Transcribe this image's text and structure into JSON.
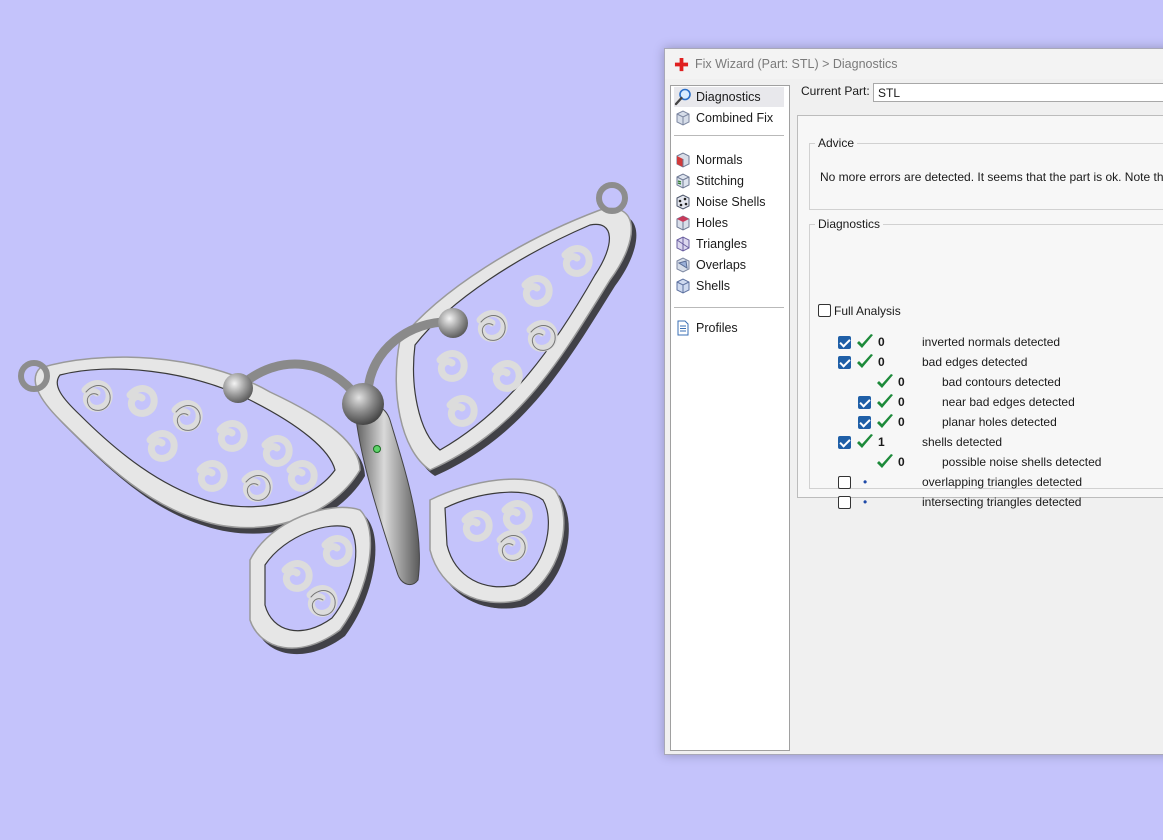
{
  "window": {
    "title": "Fix Wizard (Part: STL) > Diagnostics",
    "accent_color": "#1f5fa7",
    "background_color": "#c4c3fb"
  },
  "nav": {
    "items": [
      {
        "label": "Diagnostics",
        "icon": "magnifier-icon",
        "selected": true
      },
      {
        "label": "Combined Fix",
        "icon": "cube-icon"
      },
      {
        "label": "Normals",
        "icon": "normals-cube-icon"
      },
      {
        "label": "Stitching",
        "icon": "stitching-cube-icon"
      },
      {
        "label": "Noise Shells",
        "icon": "noise-shells-icon"
      },
      {
        "label": "Holes",
        "icon": "holes-cube-icon"
      },
      {
        "label": "Triangles",
        "icon": "triangles-icon"
      },
      {
        "label": "Overlaps",
        "icon": "overlaps-icon"
      },
      {
        "label": "Shells",
        "icon": "shells-cube-icon"
      },
      {
        "label": "Profiles",
        "icon": "document-icon"
      }
    ]
  },
  "current_part": {
    "label": "Current Part:",
    "value": "STL"
  },
  "advice": {
    "title": "Advice",
    "text": "No more errors are detected. It seems that the part is ok. Note that no"
  },
  "diagnostics": {
    "title": "Diagnostics",
    "full_analysis_label": "Full Analysis",
    "full_analysis_checked": false,
    "rows": [
      {
        "checked": true,
        "status": "ok",
        "count": "0",
        "label": "inverted normals detected",
        "indent": 0
      },
      {
        "checked": true,
        "status": "ok",
        "count": "0",
        "label": "bad edges detected",
        "indent": 0
      },
      {
        "checked": null,
        "status": "ok",
        "count": "0",
        "label": "bad contours detected",
        "indent": 1
      },
      {
        "checked": true,
        "status": "ok",
        "count": "0",
        "label": "near bad edges detected",
        "indent": 1
      },
      {
        "checked": true,
        "status": "ok",
        "count": "0",
        "label": "planar holes detected",
        "indent": 1
      },
      {
        "checked": true,
        "status": "ok",
        "count": "1",
        "label": "shells detected",
        "indent": 0
      },
      {
        "checked": null,
        "status": "ok",
        "count": "0",
        "label": "possible noise shells detected",
        "indent": 1
      },
      {
        "checked": false,
        "status": "pending",
        "count": "•",
        "label": "overlapping triangles detected",
        "indent": 0
      },
      {
        "checked": false,
        "status": "pending",
        "count": "•",
        "label": "intersecting triangles detected",
        "indent": 0
      }
    ]
  }
}
